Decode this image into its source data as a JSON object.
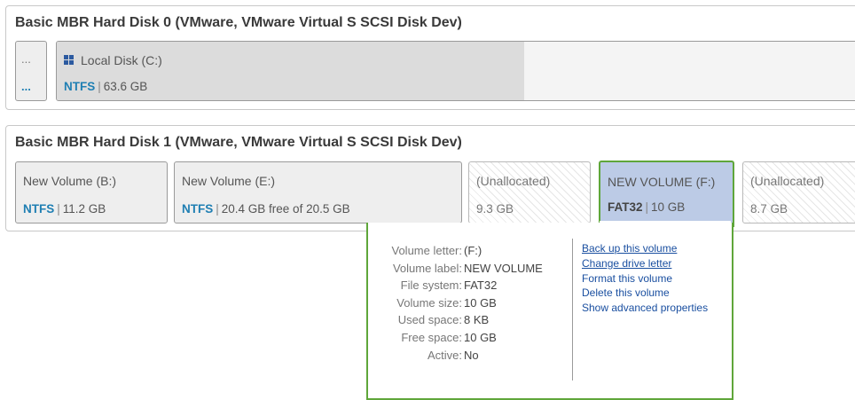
{
  "disks": [
    {
      "title": "Basic MBR Hard Disk 0 (VMware, VMware Virtual S SCSI Disk Dev)",
      "collapsed_box": {
        "top": "...",
        "bottom": "..."
      },
      "volumes": [
        {
          "name": "Local Disk (C:)",
          "icon": "windows-icon",
          "fs": "NTFS",
          "size": "63.6 GB"
        }
      ]
    },
    {
      "title": "Basic MBR Hard Disk 1 (VMware, VMware Virtual S SCSI Disk Dev)",
      "volumes": [
        {
          "name": "New Volume (B:)",
          "fs": "NTFS",
          "size": "11.2 GB"
        },
        {
          "name": "New Volume (E:)",
          "fs": "NTFS",
          "size": "20.4 GB free of 20.5 GB"
        },
        {
          "name": "(Unallocated)",
          "size": "9.3 GB"
        },
        {
          "name": "NEW VOLUME (F:)",
          "fs": "FAT32",
          "size": "10 GB"
        },
        {
          "name": "(Unallocated)",
          "size": "8.7 GB"
        }
      ]
    }
  ],
  "popup": {
    "properties": [
      {
        "key": "Volume letter:",
        "value": "(F:)"
      },
      {
        "key": "Volume label:",
        "value": "NEW VOLUME"
      },
      {
        "key": "File system:",
        "value": "FAT32"
      },
      {
        "key": "Volume size:",
        "value": "10 GB"
      },
      {
        "key": "Used space:",
        "value": "8 KB"
      },
      {
        "key": "Free space:",
        "value": "10 GB"
      },
      {
        "key": "Active:",
        "value": "No"
      }
    ],
    "actions": [
      "Back up this volume",
      "Change drive letter",
      "Format this volume",
      "Delete this volume",
      "Show advanced properties"
    ]
  },
  "colors": {
    "selected_border": "#5fa63a",
    "selected_fill": "#bccbe6",
    "fs_text": "#1f7fb3",
    "link": "#1a4fa0"
  }
}
